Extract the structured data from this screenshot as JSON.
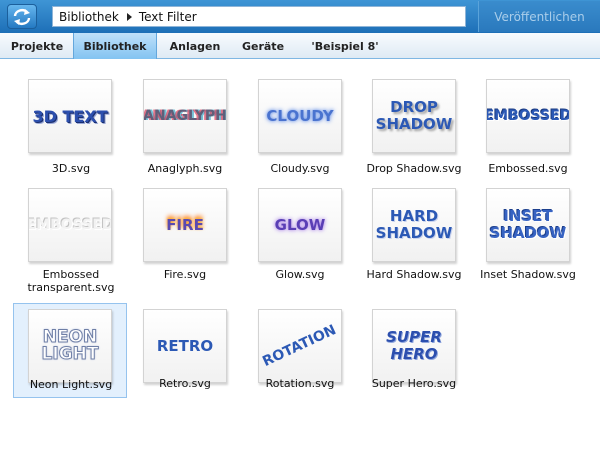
{
  "toolbar": {
    "path": [
      "Bibliothek",
      "Text Filter"
    ],
    "publish_label": "Veröffentlichen"
  },
  "tabs": [
    {
      "label": "Projekte",
      "active": false
    },
    {
      "label": "Bibliothek",
      "active": true
    },
    {
      "label": "Anlagen",
      "active": false
    },
    {
      "label": "Geräte",
      "active": false
    },
    {
      "label": "'Beispiel 8'",
      "active": false
    }
  ],
  "items": [
    {
      "file": "3D.svg",
      "preview": [
        "3D TEXT"
      ],
      "selected": false
    },
    {
      "file": "Anaglyph.svg",
      "preview": [
        "ANAGLYPH"
      ],
      "selected": false
    },
    {
      "file": "Cloudy.svg",
      "preview": [
        "CLOUDY"
      ],
      "selected": false
    },
    {
      "file": "Drop Shadow.svg",
      "preview": [
        "DROP",
        "SHADOW"
      ],
      "selected": false
    },
    {
      "file": "Embossed.svg",
      "preview": [
        "EMBOSSED"
      ],
      "selected": false
    },
    {
      "file": "Embossed transparent.svg",
      "preview": [
        "EMBOSSED"
      ],
      "selected": false
    },
    {
      "file": "Fire.svg",
      "preview": [
        "FIRE"
      ],
      "selected": false
    },
    {
      "file": "Glow.svg",
      "preview": [
        "GLOW"
      ],
      "selected": false
    },
    {
      "file": "Hard Shadow.svg",
      "preview": [
        "HARD",
        "SHADOW"
      ],
      "selected": false
    },
    {
      "file": "Inset Shadow.svg",
      "preview": [
        "INSET",
        "SHADOW"
      ],
      "selected": false
    },
    {
      "file": "Neon Light.svg",
      "preview": [
        "NEON",
        "LIGHT"
      ],
      "selected": true
    },
    {
      "file": "Retro.svg",
      "preview": [
        "RETRO"
      ],
      "selected": false
    },
    {
      "file": "Rotation.svg",
      "preview": [
        "ROTATION"
      ],
      "selected": false
    },
    {
      "file": "Super Hero.svg",
      "preview": [
        "SUPER",
        "HERO"
      ],
      "selected": false
    }
  ]
}
